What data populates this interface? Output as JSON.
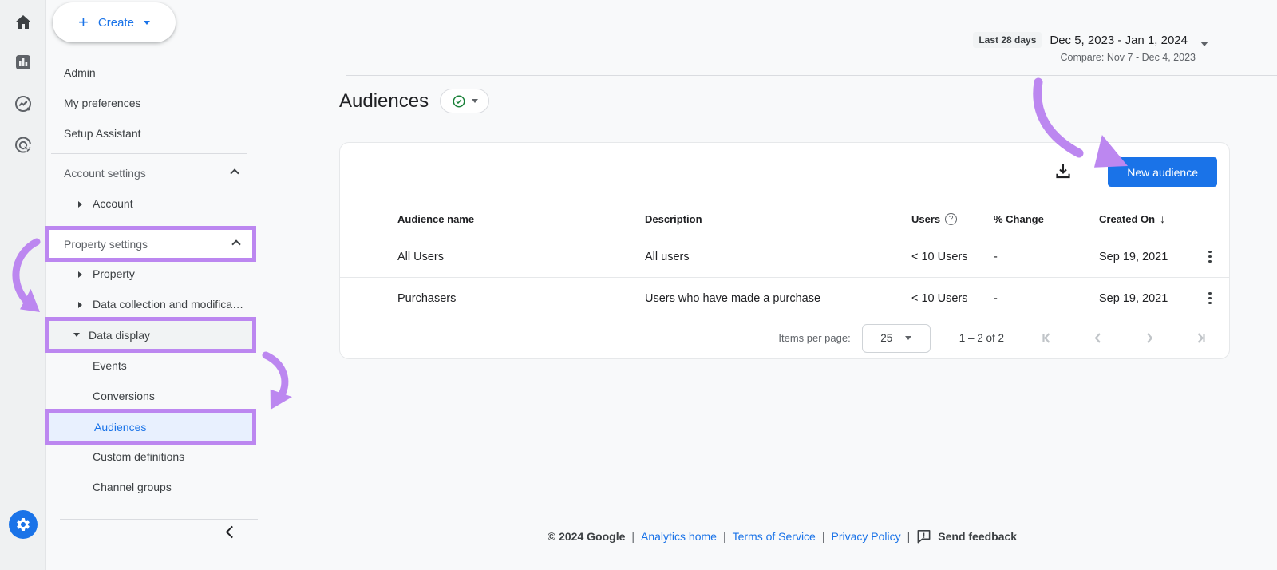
{
  "colors": {
    "accent_blue": "#1a73e8",
    "annotation_purple": "#bc87f0",
    "check_green": "#188038"
  },
  "rail": {
    "icons": [
      "home-icon",
      "reports-icon",
      "explore-icon",
      "advertising-icon",
      "admin-gear-icon"
    ]
  },
  "sidebar": {
    "create_label": "Create",
    "items": {
      "admin": "Admin",
      "my_preferences": "My preferences",
      "setup_assistant": "Setup Assistant",
      "account_settings": "Account settings",
      "account": "Account",
      "property_settings": "Property settings",
      "property": "Property",
      "data_collection": "Data collection and modifica…",
      "data_display": "Data display",
      "events": "Events",
      "conversions": "Conversions",
      "audiences": "Audiences",
      "custom_definitions": "Custom definitions",
      "channel_groups": "Channel groups"
    }
  },
  "header": {
    "range_chip": "Last 28 days",
    "range": "Dec 5, 2023 - Jan 1, 2024",
    "compare": "Compare: Nov 7 - Dec 4, 2023"
  },
  "page": {
    "title": "Audiences"
  },
  "table": {
    "new_audience_label": "New audience",
    "columns": {
      "name": "Audience name",
      "description": "Description",
      "users": "Users",
      "change": "% Change",
      "created": "Created On"
    },
    "rows": [
      {
        "name": "All Users",
        "description": "All users",
        "users": "< 10 Users",
        "change": "-",
        "created": "Sep 19, 2021"
      },
      {
        "name": "Purchasers",
        "description": "Users who have made a purchase",
        "users": "< 10 Users",
        "change": "-",
        "created": "Sep 19, 2021"
      }
    ],
    "pagination": {
      "items_per_page_label": "Items per page:",
      "page_size": "25",
      "range": "1 – 2 of 2"
    }
  },
  "footer": {
    "copyright": "© 2024 Google",
    "links": {
      "analytics_home": "Analytics home",
      "terms": "Terms of Service",
      "privacy": "Privacy Policy"
    },
    "send_feedback": "Send feedback"
  }
}
